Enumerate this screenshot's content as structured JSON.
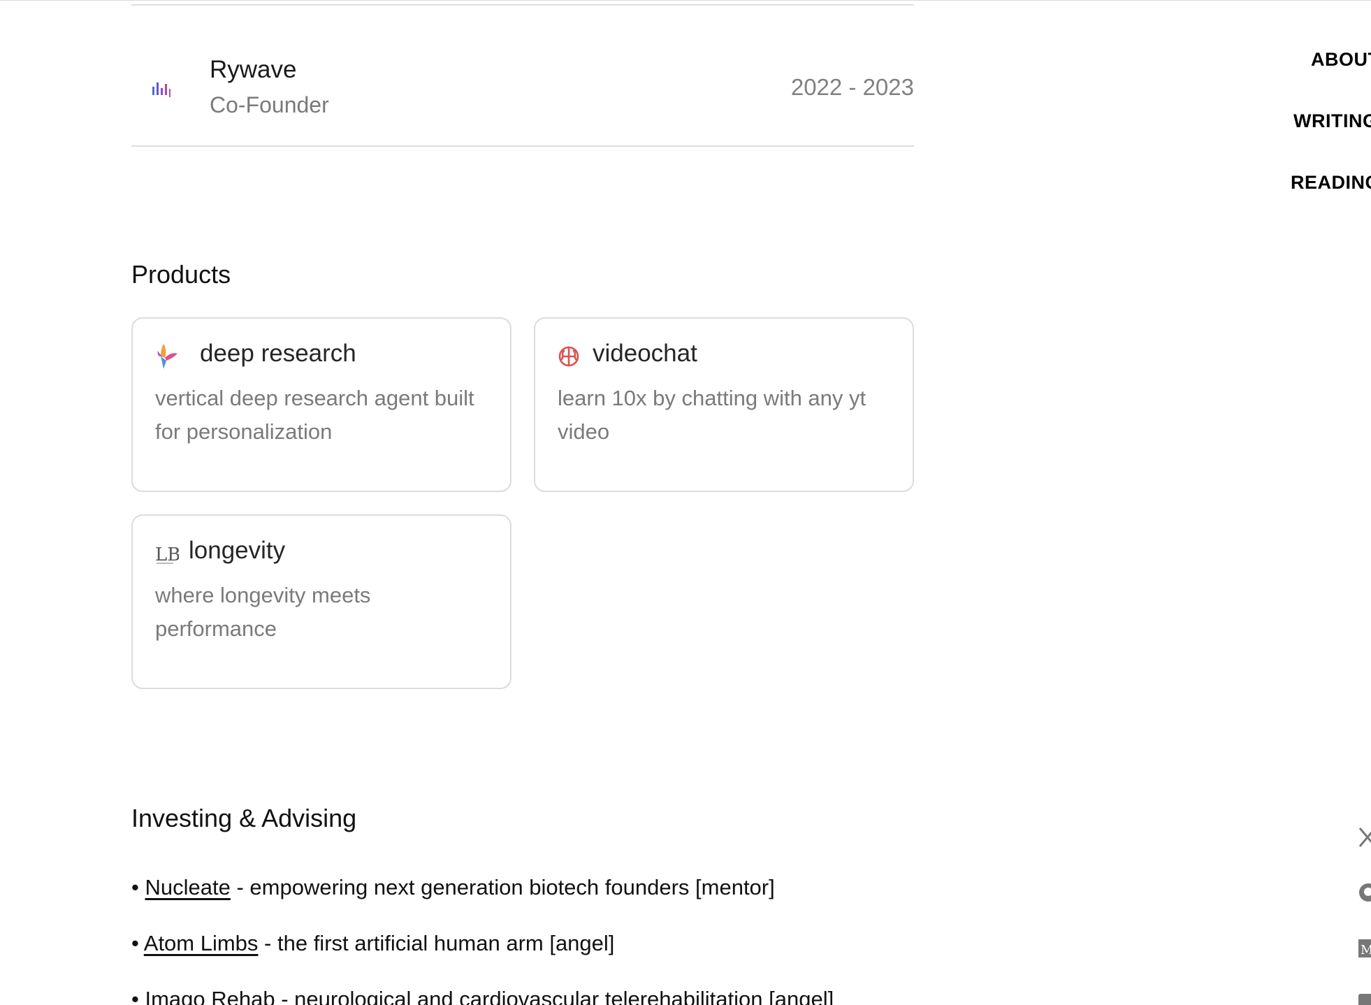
{
  "experience": {
    "company": "Rywave",
    "role": "Co-Founder",
    "years": "2022 - 2023",
    "logo_icon": "bar-wave-icon"
  },
  "products": {
    "title": "Products",
    "items": [
      {
        "title": "deep research",
        "description": "vertical deep research agent built for personalization",
        "icon": "hummingbird-icon"
      },
      {
        "title": "videochat",
        "description": "learn 10x by chatting with any yt video",
        "icon": "brain-icon"
      },
      {
        "title": "longevity",
        "description": "where longevity meets performance",
        "icon": "lb-monogram-icon"
      }
    ]
  },
  "investing": {
    "title": "Investing & Advising",
    "items": [
      {
        "bullet": "•",
        "link": "Nucleate",
        "text": " - empowering next generation biotech founders [mentor]"
      },
      {
        "bullet": "•",
        "link": "Atom Limbs",
        "text": " - the first artificial human arm [angel]"
      },
      {
        "bullet": "•",
        "link": "Imago Rehab",
        "text": " - neurological and cardiovascular telerehabilitation [angel]"
      }
    ]
  },
  "nav": {
    "about": "ABOUT",
    "writing": "WRITING",
    "reading": "READING"
  },
  "social": [
    "x-icon",
    "github-icon",
    "medium-icon",
    "linkedin-icon"
  ],
  "colors": {
    "text": "#111111",
    "muted": "#7a7a7a",
    "border": "#dcdcdc",
    "brain_red": "#d9534f"
  }
}
